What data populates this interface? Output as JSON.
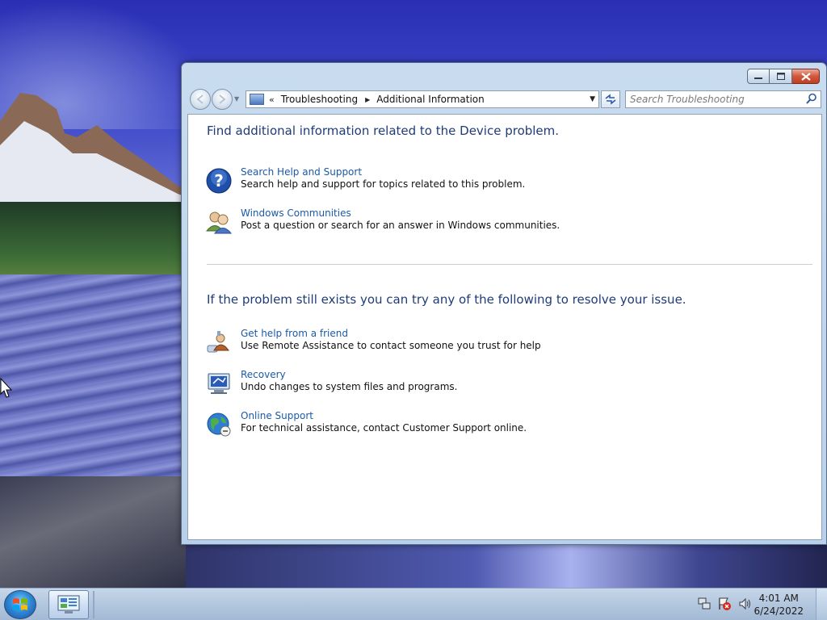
{
  "window": {
    "caption_buttons": {
      "minimize": "minimize",
      "maximize": "maximize",
      "close": "close"
    },
    "address_bar": {
      "breadcrumb": [
        "Troubleshooting",
        "Additional Information"
      ],
      "overflow_chevron": "«"
    },
    "search": {
      "placeholder": "Search Troubleshooting"
    },
    "content": {
      "heading1": "Find additional information related to the Device problem.",
      "section1_items": [
        {
          "title": "Search Help and Support",
          "description": "Search help and support for topics related to this problem.",
          "icon": "help-icon"
        },
        {
          "title": "Windows Communities",
          "description": "Post a question or search for an answer in Windows communities.",
          "icon": "communities-icon"
        }
      ],
      "heading2": "If the problem still exists you can try any of the following to resolve your issue.",
      "section2_items": [
        {
          "title": "Get help from a friend",
          "description": "Use Remote Assistance to contact someone you trust for help",
          "icon": "remote-assistance-icon"
        },
        {
          "title": "Recovery",
          "description": "Undo changes to system files and programs.",
          "icon": "recovery-icon"
        },
        {
          "title": "Online Support",
          "description": "For technical assistance, contact Customer Support online.",
          "icon": "online-support-icon"
        }
      ]
    }
  },
  "taskbar": {
    "clock": {
      "time": "4:01 AM",
      "date": "6/24/2022"
    },
    "tray_icons": [
      "network-icon",
      "action-center-icon",
      "volume-icon"
    ]
  },
  "colors": {
    "link": "#1b5aa7",
    "heading": "#1e3c78",
    "window_frame": "#c9dcef",
    "taskbar": "#b4c8df"
  }
}
